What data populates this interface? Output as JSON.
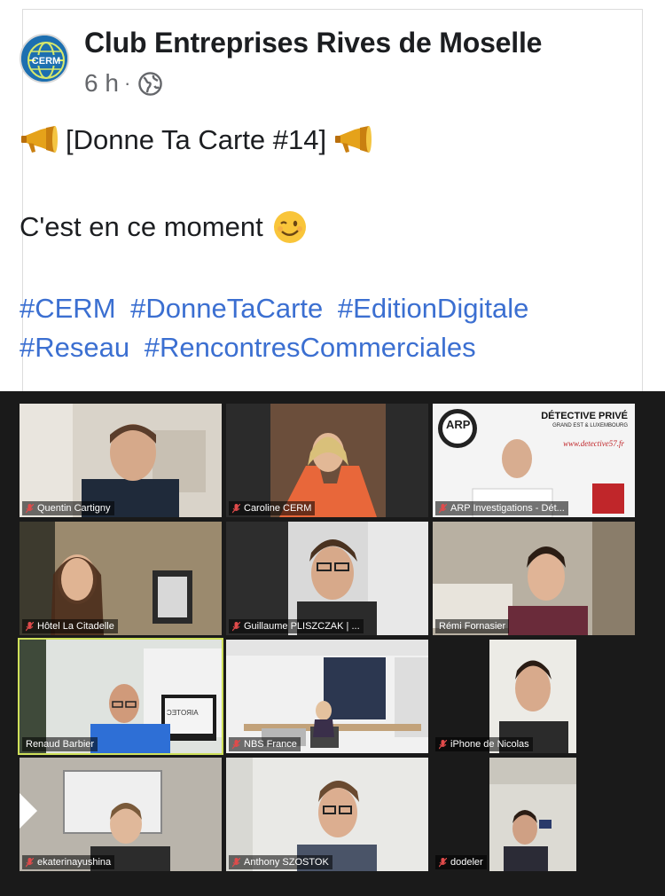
{
  "post": {
    "page_name": "Club Entreprises Rives de Moselle",
    "time": "6 h",
    "separator": "·",
    "privacy_icon": "globe-icon",
    "line1_text": "[Donne Ta Carte #14]",
    "line1_emoji": "megaphone-icon",
    "line2_text": "C'est en ce moment",
    "line2_emoji": "winking-face-icon",
    "hashtags": [
      "#CERM",
      "#DonneTaCarte",
      "#EditionDigitale",
      "#Reseau",
      "#RencontresCommerciales"
    ]
  },
  "video_call": {
    "participants": [
      {
        "name": "Quentin Cartigny",
        "muted": true
      },
      {
        "name": "Caroline CERM",
        "muted": true
      },
      {
        "name": "ARP Investigations - Dét...",
        "muted": true
      },
      {
        "name": "Hôtel La Citadelle",
        "muted": true
      },
      {
        "name": "Guillaume PLISZCZAK | ...",
        "muted": true
      },
      {
        "name": "Rémi Fornasier",
        "muted": false
      },
      {
        "name": "Renaud Barbier",
        "muted": false,
        "active_speaker": true
      },
      {
        "name": "NBS France",
        "muted": true
      },
      {
        "name": "iPhone de Nicolas",
        "muted": true
      },
      {
        "name": "ekaterinayushina",
        "muted": true
      },
      {
        "name": "Anthony SZOSTOK",
        "muted": true
      },
      {
        "name": "dodeler",
        "muted": true
      }
    ],
    "arp_banner": {
      "logo": "ARP",
      "title": "DÉTECTIVE PRIVÉ",
      "subtitle": "GRAND EST & LUXEMBOURG",
      "url": "www.detective57.fr"
    },
    "screen_brand": "AIROTEC"
  },
  "colors": {
    "text": "#1c1e21",
    "secondary": "#65676b",
    "hashtag": "#3b6fd1",
    "call_background": "#1a1a1a",
    "active_outline": "#cfe05a"
  }
}
